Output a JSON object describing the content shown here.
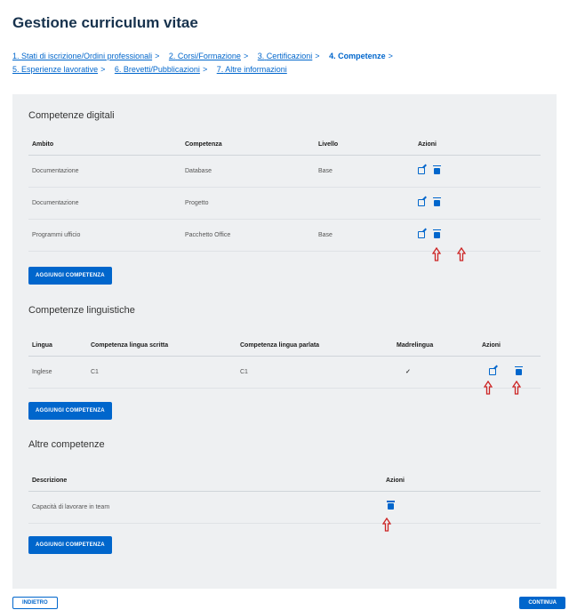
{
  "page_title": "Gestione curriculum vitae",
  "steps": [
    {
      "num": "1.",
      "label": "Stati di iscrizione/Ordini professionali",
      "sep": ">"
    },
    {
      "num": "2.",
      "label": "Corsi/Formazione",
      "sep": ">"
    },
    {
      "num": "3.",
      "label": "Certificazioni",
      "sep": ">"
    },
    {
      "num": "4.",
      "label": "Competenze",
      "sep": ">"
    },
    {
      "num": "5.",
      "label": "Esperienze lavorative",
      "sep": ">"
    },
    {
      "num": "6.",
      "label": "Brevetti/Pubblicazioni",
      "sep": ">"
    },
    {
      "num": "7.",
      "label": "Altre informazioni",
      "sep": ""
    }
  ],
  "digital": {
    "title": "Competenze digitali",
    "headers": [
      "Ambito",
      "Competenza",
      "Livello",
      "Azioni"
    ],
    "rows": [
      [
        "Documentazione",
        "Database",
        "Base"
      ],
      [
        "Documentazione",
        "Progetto",
        ""
      ],
      [
        "Programmi ufficio",
        "Pacchetto Office",
        "Base"
      ]
    ],
    "button": "Aggiungi competenza"
  },
  "language": {
    "title": "Competenze linguistiche",
    "headers": [
      "Lingua",
      "Competenza lingua scritta",
      "Competenza lingua parlata",
      "Madrelingua",
      "Azioni"
    ],
    "rows": [
      [
        "Inglese",
        "C1",
        "C1",
        "✓"
      ]
    ],
    "button": "Aggiungi competenza"
  },
  "other": {
    "title": "Altre competenze",
    "headers": [
      "Descrizione",
      "Azioni"
    ],
    "rows": [
      [
        "Capacità di lavorare in team"
      ]
    ],
    "button": "Aggiungi competenza"
  },
  "footer": {
    "back": "Indietro",
    "continue": "Continua"
  },
  "colors": {
    "accent": "#0066cc",
    "arrow": "#cc2222",
    "panel": "#eef0f2"
  }
}
